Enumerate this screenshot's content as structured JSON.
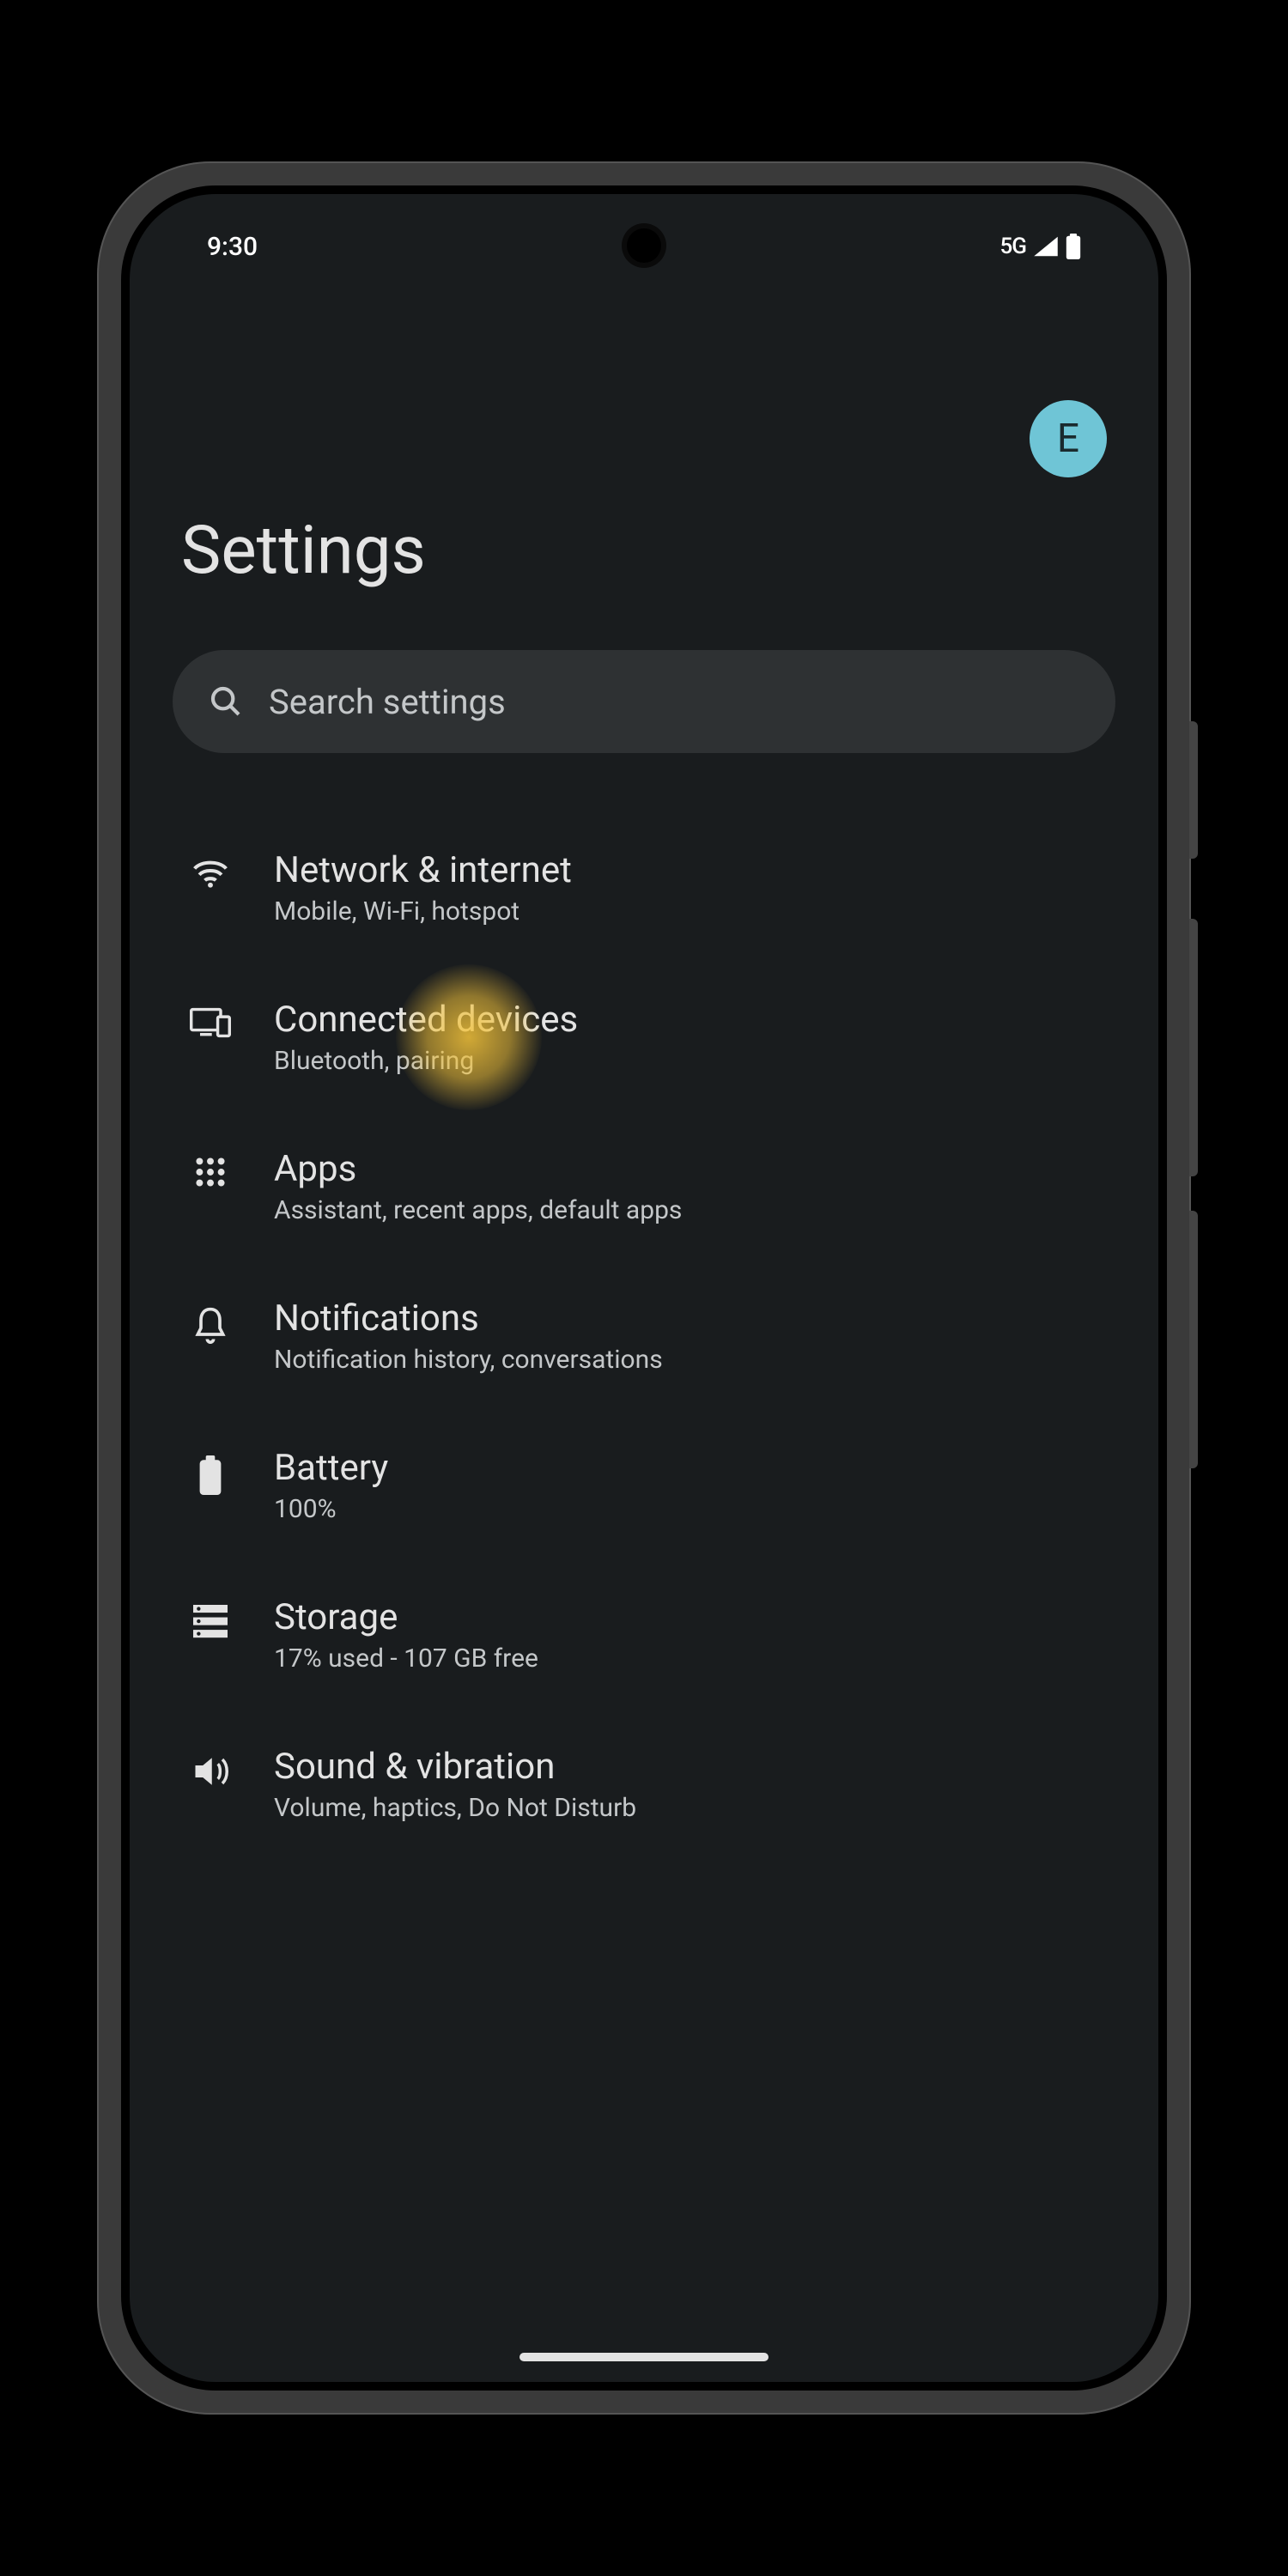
{
  "status": {
    "time": "9:30",
    "network": "5G"
  },
  "avatar": {
    "initial": "E"
  },
  "page": {
    "title": "Settings"
  },
  "search": {
    "placeholder": "Search settings"
  },
  "items": [
    {
      "title": "Network & internet",
      "subtitle": "Mobile, Wi-Fi, hotspot"
    },
    {
      "title": "Connected devices",
      "subtitle": "Bluetooth, pairing"
    },
    {
      "title": "Apps",
      "subtitle": "Assistant, recent apps, default apps"
    },
    {
      "title": "Notifications",
      "subtitle": "Notification history, conversations"
    },
    {
      "title": "Battery",
      "subtitle": "100%"
    },
    {
      "title": "Storage",
      "subtitle": "17% used - 107 GB free"
    },
    {
      "title": "Sound & vibration",
      "subtitle": "Volume, haptics, Do Not Disturb"
    }
  ]
}
